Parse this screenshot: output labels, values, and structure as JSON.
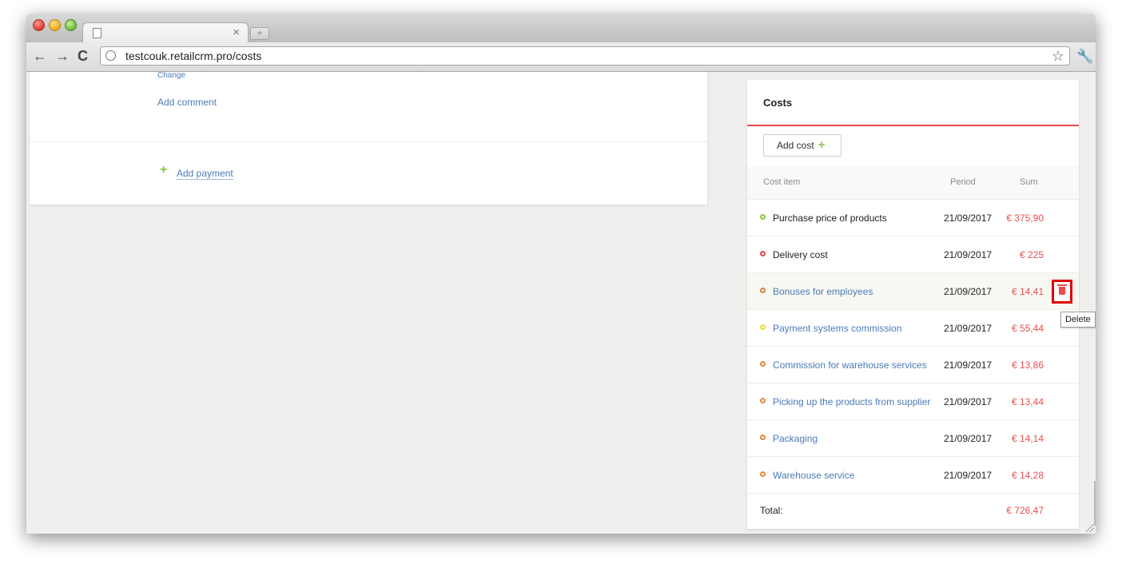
{
  "browser": {
    "tab_close_glyph": "×",
    "new_tab_glyph": "+",
    "url": "testcouk.retailcrm.pro/costs",
    "back_glyph": "←",
    "forward_glyph": "→",
    "reload_glyph": "C",
    "star_glyph": "☆",
    "wrench_glyph": "🔧"
  },
  "left_panel": {
    "change_label": "Change",
    "add_comment_label": "Add comment",
    "add_payment_plus": "+",
    "add_payment_label": "Add payment"
  },
  "costs": {
    "title": "Costs",
    "add_cost_label": "Add cost",
    "add_cost_plus": "+",
    "headers": {
      "item": "Cost item",
      "period": "Period",
      "sum": "Sum"
    },
    "rows": [
      {
        "name": "Purchase price of products",
        "period": "21/09/2017",
        "sum": "€ 375,90",
        "dot_color": "#8cc43e",
        "is_link": false
      },
      {
        "name": "Delivery cost",
        "period": "21/09/2017",
        "sum": "€ 225",
        "dot_color": "#e8474d",
        "is_link": false
      },
      {
        "name": "Bonuses for employees",
        "period": "21/09/2017",
        "sum": "€ 14,41",
        "dot_color": "#c8873e",
        "is_link": true
      },
      {
        "name": "Payment systems commission",
        "period": "21/09/2017",
        "sum": "€ 55,44",
        "dot_color": "#e8e03a",
        "is_link": true
      },
      {
        "name": "Commission for warehouse services",
        "period": "21/09/2017",
        "sum": "€ 13,86",
        "dot_color": "#e8873e",
        "is_link": true
      },
      {
        "name": "Picking up the products from supplier",
        "period": "21/09/2017",
        "sum": "€ 13,44",
        "dot_color": "#e8873e",
        "is_link": true
      },
      {
        "name": "Packaging",
        "period": "21/09/2017",
        "sum": "€ 14,14",
        "dot_color": "#e8873e",
        "is_link": true
      },
      {
        "name": "Warehouse service",
        "period": "21/09/2017",
        "sum": "€ 14,28",
        "dot_color": "#e8873e",
        "is_link": true
      }
    ],
    "delete_tooltip": "Delete",
    "total_label": "Total:",
    "total_sum": "€ 726,47"
  }
}
